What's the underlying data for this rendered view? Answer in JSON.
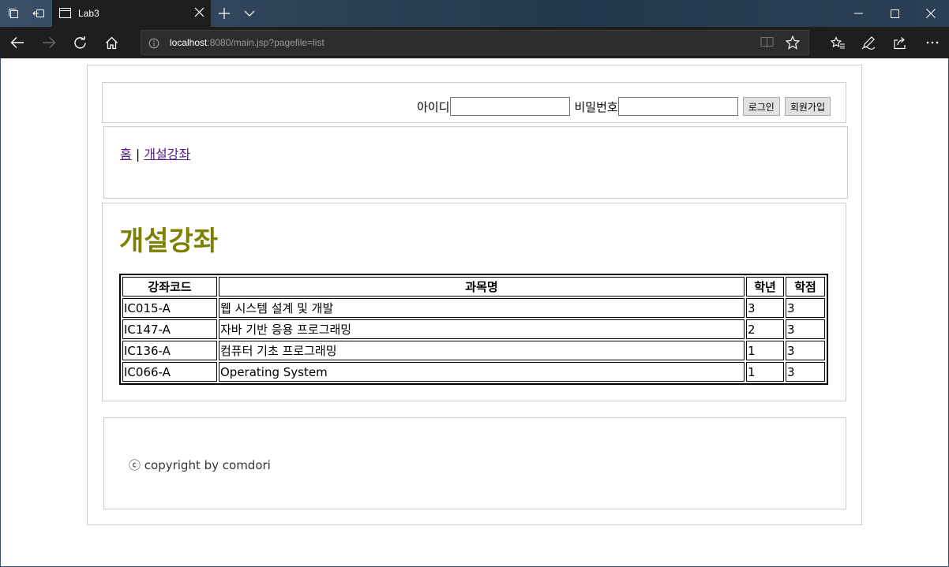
{
  "browser": {
    "tab_title": "Lab3",
    "url_host": "localhost",
    "url_rest": ":8080/main.jsp?pagefile=list"
  },
  "login": {
    "id_label": "아이디",
    "id_value": "",
    "pw_label": "비밀번호",
    "pw_value": "",
    "login_button": "로그인",
    "signup_button": "회원가입"
  },
  "menu": {
    "home": "홈",
    "separator": "|",
    "courses": "개설강좌"
  },
  "content": {
    "title": "개설강좌",
    "title_color": "#808000",
    "columns": [
      "강좌코드",
      "과목명",
      "학년",
      "학점"
    ],
    "rows": [
      [
        "IC015-A",
        "웹 시스템 설계 및 개발",
        "3",
        "3"
      ],
      [
        "IC147-A",
        "자바 기반 응용 프로그래밍",
        "2",
        "3"
      ],
      [
        "IC136-A",
        "컴퓨터 기초 프로그래밍",
        "1",
        "3"
      ],
      [
        "IC066-A",
        "Operating System",
        "1",
        "3"
      ]
    ]
  },
  "footer": {
    "copyright": "ⓒ copyright by comdori"
  }
}
